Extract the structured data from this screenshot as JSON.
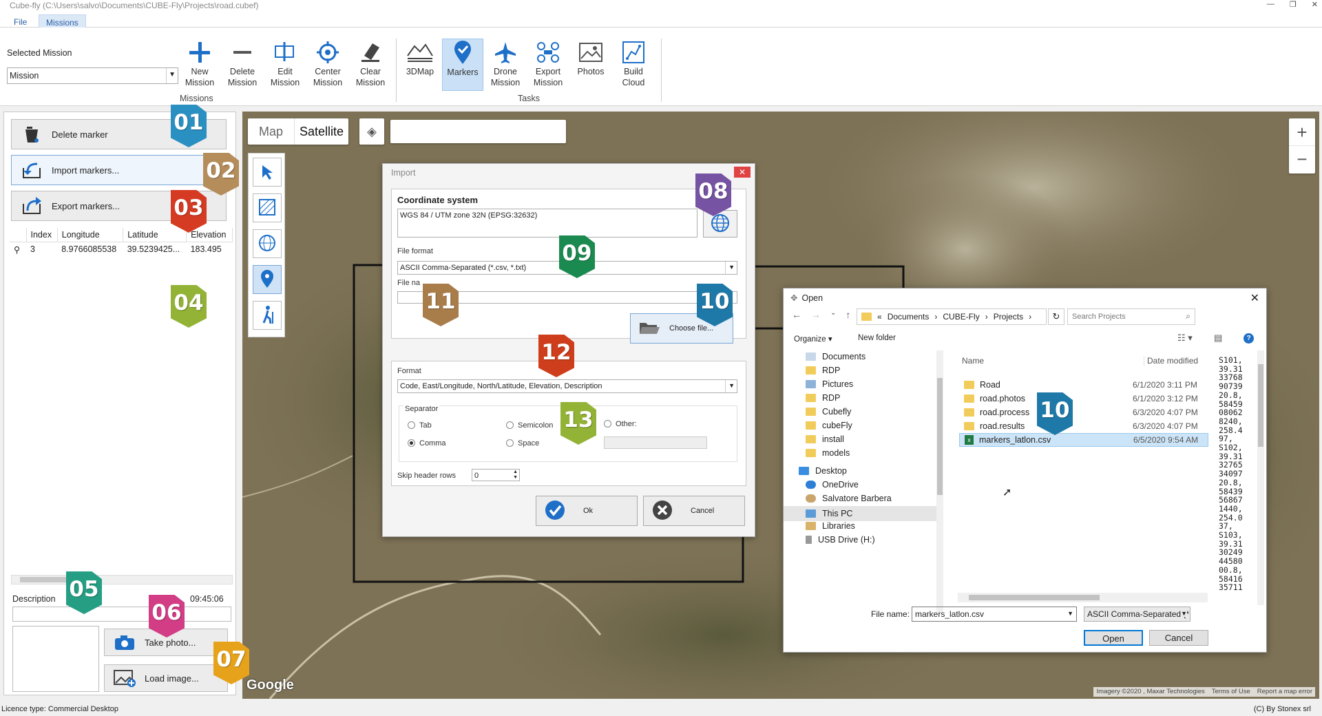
{
  "window": {
    "title": "Cube-fly (C:\\Users\\salvo\\Documents\\CUBE-Fly\\Projects\\road.cubef)"
  },
  "menu": {
    "file": "File",
    "missions": "Missions"
  },
  "ribbon": {
    "selected_mission_label": "Selected Mission",
    "mission_select_value": "Mission",
    "missions_group": "Missions",
    "tasks_group": "Tasks",
    "buttons": [
      {
        "label1": "New",
        "label2": "Mission",
        "icon": "plus-icon"
      },
      {
        "label1": "Delete",
        "label2": "Mission",
        "icon": "minus-icon"
      },
      {
        "label1": "Edit",
        "label2": "Mission",
        "icon": "edit-icon"
      },
      {
        "label1": "Center",
        "label2": "Mission",
        "icon": "crosshair-icon"
      },
      {
        "label1": "Clear",
        "label2": "Mission",
        "icon": "eraser-icon"
      },
      {
        "label1": "3DMap",
        "label2": "",
        "icon": "terrain-icon"
      },
      {
        "label1": "Markers",
        "label2": "",
        "icon": "marker-icon"
      },
      {
        "label1": "Drone",
        "label2": "Mission",
        "icon": "plane-icon"
      },
      {
        "label1": "Export",
        "label2": "Mission",
        "icon": "export-icon"
      },
      {
        "label1": "Photos",
        "label2": "",
        "icon": "photo-icon"
      },
      {
        "label1": "Build",
        "label2": "Cloud",
        "icon": "cloud-build-icon"
      }
    ]
  },
  "left": {
    "delete_marker": "Delete marker",
    "import_markers": "Import markers...",
    "export_markers": "Export markers...",
    "table": {
      "headers": [
        "Index",
        "Longitude",
        "Latitude",
        "Elevation"
      ],
      "row": {
        "index": "3",
        "lon": "8.9766085538",
        "lat": "39.5239425...",
        "elev": "183.495"
      }
    },
    "description_label": "Description",
    "time": "09:45:06",
    "take_photo": "Take photo...",
    "load_image": "Load image..."
  },
  "map": {
    "tab_map": "Map",
    "tab_satellite": "Satellite",
    "zoom_in": "+",
    "zoom_out": "−",
    "google": "Google",
    "attribution": "Imagery ©2020 , Maxar Technologies",
    "terms": "Terms of Use",
    "report": "Report a map error"
  },
  "import": {
    "title": "Import",
    "coord_system_label": "Coordinate system",
    "coord_system_value": "WGS 84 / UTM zone 32N (EPSG:32632)",
    "file_format_label": "File format",
    "file_format_value": "ASCII Comma-Separated (*.csv, *.txt)",
    "file_name_label": "File na",
    "choose_file": "Choose file...",
    "format_label": "Format",
    "format_value": "Code, East/Longitude, North/Latitude, Elevation, Description",
    "separator_label": "Separator",
    "tab": "Tab",
    "semicolon": "Semicolon",
    "other": "Other:",
    "comma": "Comma",
    "space": "Space",
    "skip_header": "Skip header rows",
    "skip_value": "0",
    "ok": "Ok",
    "cancel": "Cancel"
  },
  "open": {
    "title": "Open",
    "path": [
      "«",
      "Documents",
      "CUBE-Fly",
      "Projects"
    ],
    "search_placeholder": "Search Projects",
    "organize": "Organize ▾",
    "new_folder": "New folder",
    "nav": [
      "Documents",
      "RDP",
      "Pictures",
      "RDP",
      "Cubefly",
      "cubeFly",
      "install",
      "models",
      "Desktop",
      "OneDrive",
      "Salvatore Barbera",
      "This PC",
      "Libraries",
      "USB Drive (H:)"
    ],
    "col_name": "Name",
    "col_date": "Date modified",
    "files": [
      {
        "name": "Road",
        "date": "6/1/2020 3:11 PM"
      },
      {
        "name": "road.photos",
        "date": "6/1/2020 3:12 PM"
      },
      {
        "name": "road.process",
        "date": "6/3/2020 4:07 PM"
      },
      {
        "name": "road.results",
        "date": "6/3/2020 4:07 PM"
      },
      {
        "name": "markers_latlon.csv",
        "date": "6/5/2020 9:54 AM"
      }
    ],
    "preview": [
      "S101,",
      "39.31",
      "33768",
      "90739",
      "20.8,",
      "58459",
      "08062",
      "8240,",
      "258.4",
      "97,",
      "S102,",
      "39.31",
      "32765",
      "34097",
      "20.8,",
      "58439",
      "56867",
      "1440,",
      "254.0",
      "37,",
      "S103,",
      "39.31",
      "30249",
      "44580",
      "00.8,",
      "58416",
      "35711"
    ],
    "file_name_label": "File name:",
    "file_name_value": "markers_latlon.csv",
    "filter_value": "ASCII Comma-Separated (*.csv,",
    "open_btn": "Open",
    "cancel_btn": "Cancel"
  },
  "badges": [
    "01",
    "02",
    "03",
    "04",
    "05",
    "06",
    "07",
    "08",
    "09",
    "10",
    "11",
    "12",
    "13",
    "10"
  ],
  "status": {
    "license": "Licence type: Commercial Desktop",
    "copyright": "(C) By Stonex srl"
  }
}
